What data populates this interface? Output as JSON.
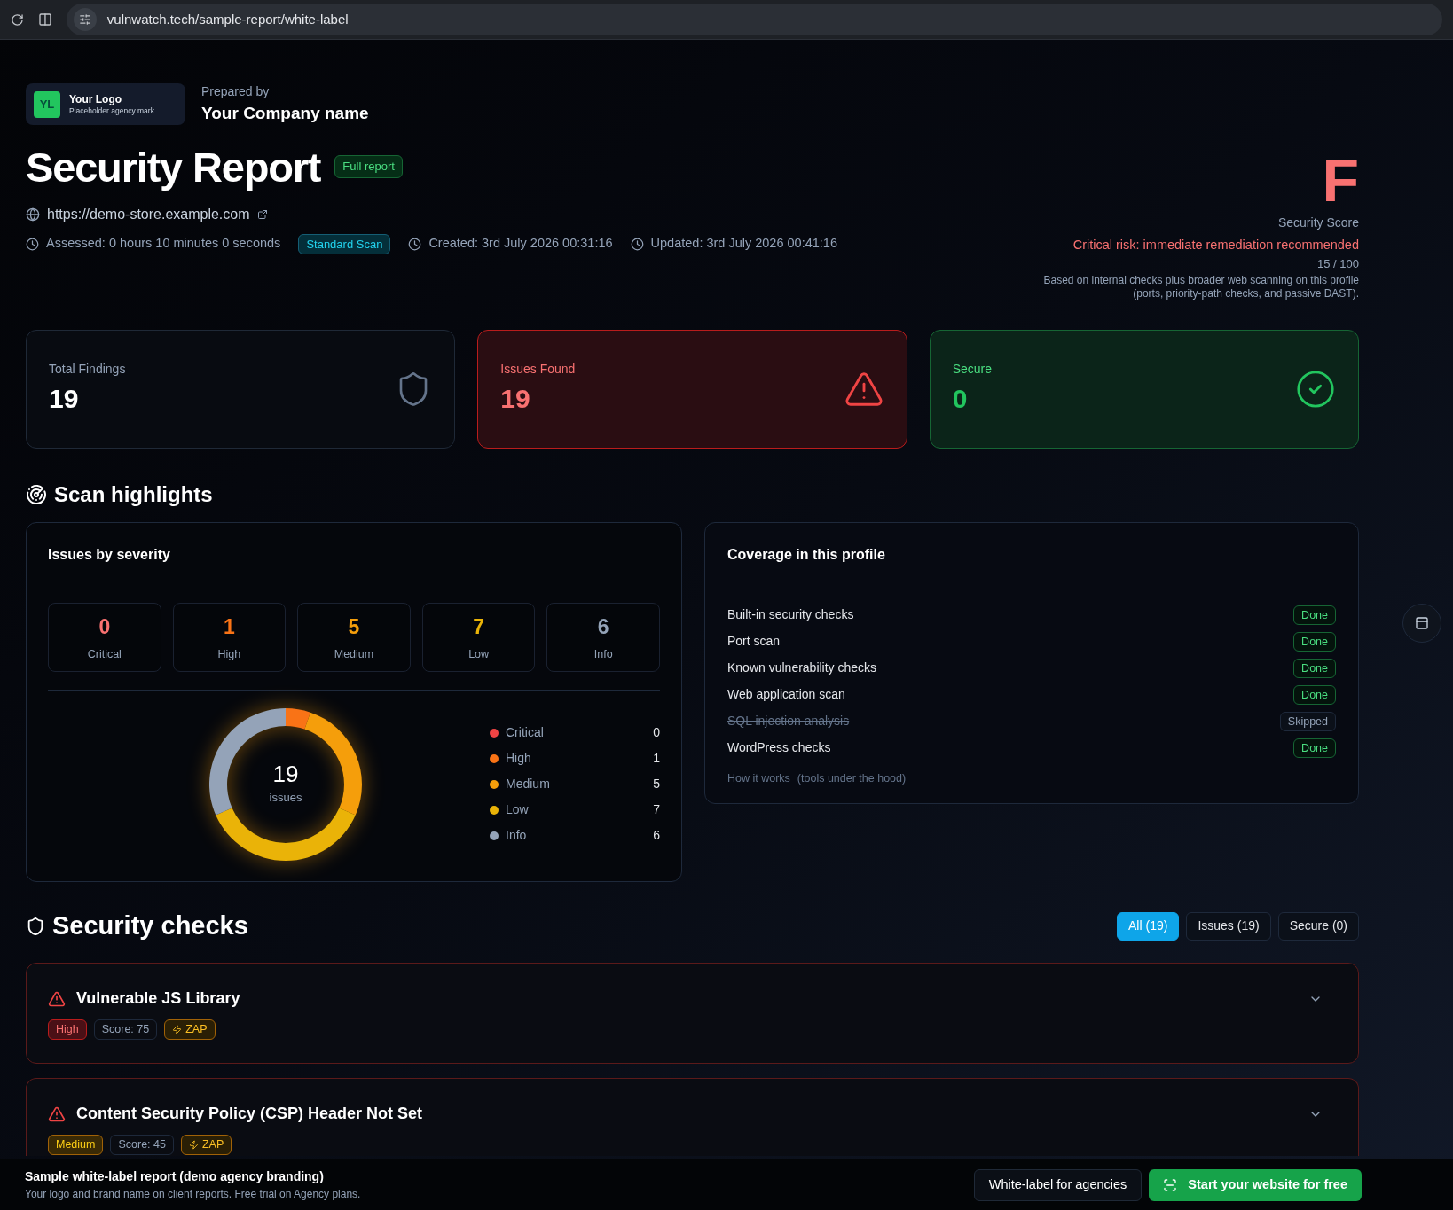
{
  "browser": {
    "url": "vulnwatch.tech/sample-report/white-label"
  },
  "brand": {
    "logo_initials": "YL",
    "logo_title": "Your Logo",
    "logo_subtitle": "Placeholder agency mark",
    "prepared_label": "Prepared by",
    "company": "Your Company name"
  },
  "report": {
    "title": "Security Report",
    "badge": "Full report",
    "url": "https://demo-store.example.com",
    "assessed": "Assessed: 0 hours 10 minutes 0 seconds",
    "scan_type": "Standard Scan",
    "created": "Created: 3rd July 2026 00:31:16",
    "updated": "Updated: 3rd July 2026 00:41:16"
  },
  "score": {
    "grade": "F",
    "label": "Security Score",
    "risk": "Critical risk: immediate remediation recommended",
    "value": "15 / 100",
    "note_1": "Based on internal checks plus broader web scanning on this profile",
    "note_2": "(ports, priority-path checks, and passive DAST)."
  },
  "summary_cards": [
    {
      "kind": "total",
      "label": "Total Findings",
      "value": "19"
    },
    {
      "kind": "issues",
      "label": "Issues Found",
      "value": "19"
    },
    {
      "kind": "secure",
      "label": "Secure",
      "value": "0"
    }
  ],
  "highlights": {
    "title": "Scan highlights",
    "severity_panel": {
      "title": "Issues by severity",
      "tiles": [
        {
          "count": "0",
          "label": "Critical",
          "color": "#f87171"
        },
        {
          "count": "1",
          "label": "High",
          "color": "#f97316"
        },
        {
          "count": "5",
          "label": "Medium",
          "color": "#f59e0b"
        },
        {
          "count": "7",
          "label": "Low",
          "color": "#eab308"
        },
        {
          "count": "6",
          "label": "Info",
          "color": "#94a3b8"
        }
      ],
      "chart_data": {
        "type": "donut",
        "categories": [
          "Critical",
          "High",
          "Medium",
          "Low",
          "Info"
        ],
        "values": [
          0,
          5.26,
          26.32,
          36.84,
          31.58
        ]
      },
      "center_value": "19",
      "center_label": "issues",
      "legend": [
        {
          "count": "0",
          "color": "#ef4444"
        },
        {
          "count": "1",
          "color": "#f97316"
        },
        {
          "count": "5",
          "color": "#f59e0b"
        },
        {
          "count": "7",
          "color": "#eab308"
        },
        {
          "count": "6",
          "color": "#94a3b8"
        }
      ]
    },
    "coverage_panel": {
      "title": "Coverage in this profile",
      "items": [
        {
          "label": "Built-in security checks",
          "status": "Done",
          "skipped": false
        },
        {
          "label": "Port scan",
          "status": "Done",
          "skipped": false
        },
        {
          "label": "Known vulnerability checks",
          "status": "Done",
          "skipped": false
        },
        {
          "label": "Web application scan",
          "status": "Done",
          "skipped": false
        },
        {
          "label": "SQL injection analysis",
          "status": "Skipped",
          "skipped": true
        },
        {
          "label": "WordPress checks",
          "status": "Done",
          "skipped": false
        }
      ],
      "link": "How it works",
      "link_note": "(tools under the hood)"
    }
  },
  "checks": {
    "title": "Security checks",
    "filters": [
      {
        "label": "All (19)",
        "selected": true
      },
      {
        "label": "Issues (19)",
        "selected": false
      },
      {
        "label": "Secure (0)",
        "selected": false
      }
    ],
    "items": [
      {
        "title": "Vulnerable JS Library",
        "severity": "High",
        "kind": "high",
        "score": "Score: 75",
        "source": "ZAP",
        "expanded": false
      },
      {
        "title": "Content Security Policy (CSP) Header Not Set",
        "severity": "Medium",
        "kind": "medium",
        "score": "Score: 45",
        "source": "ZAP",
        "expanded": false
      }
    ]
  },
  "footer_bar": {
    "title": "Sample white-label report (demo agency branding)",
    "subtitle": "Your logo and brand name on client reports. Free trial on Agency plans.",
    "secondary_button": "White-label for agencies",
    "primary_button": "Start your website for free"
  }
}
